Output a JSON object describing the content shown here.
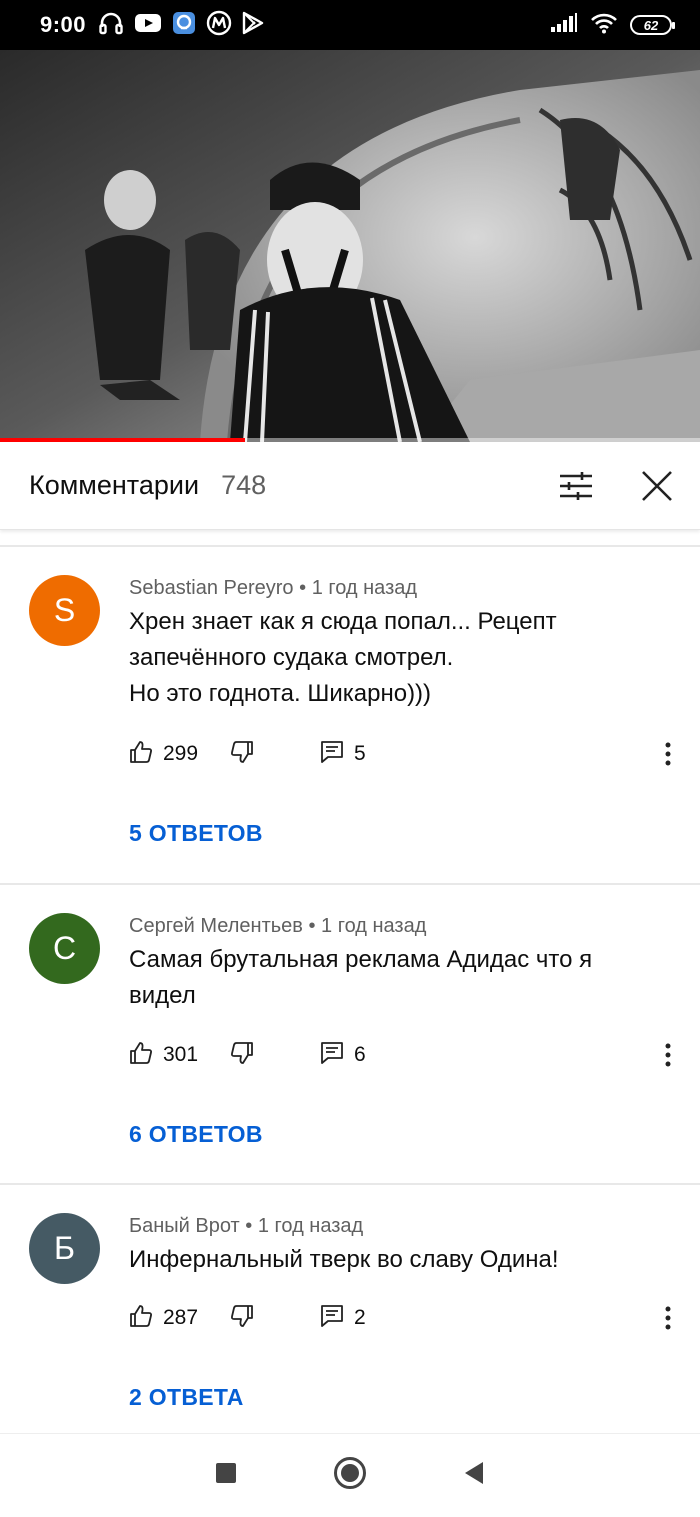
{
  "status_bar": {
    "time": "9:00",
    "left_icons": [
      "headphones-icon",
      "youtube-icon",
      "gallery-app-icon",
      "metro-icon",
      "play-store-icon"
    ],
    "right_icons": [
      "signal-icon",
      "wifi-icon"
    ],
    "battery": "62"
  },
  "video": {
    "progress_percent": 35,
    "colors": {
      "progress": "#ff0000"
    }
  },
  "comments_header": {
    "title": "Комментарии",
    "count": "748"
  },
  "comments": [
    {
      "avatar_letter": "S",
      "avatar_color": "#ef6c00",
      "author": "Sebastian Pereyro",
      "time": "1 год назад",
      "lines": [
        "Хрен знает как я сюда попал... Рецепт",
        "запечённого судака смотрел.",
        "Но это годнота. Шикарно)))"
      ],
      "likes": "299",
      "replies_count": "5",
      "replies_label": "5 ОТВЕТОВ"
    },
    {
      "avatar_letter": "С",
      "avatar_color": "#33691e",
      "author": "Сергей Мелентьев",
      "time": "1 год назад",
      "lines": [
        "Самая брутальная реклама Адидас что я",
        "видел"
      ],
      "likes": "301",
      "replies_count": "6",
      "replies_label": "6 ОТВЕТОВ"
    },
    {
      "avatar_letter": "Б",
      "avatar_color": "#455a64",
      "author": "Баный Врот",
      "time": "1 год назад",
      "lines": [
        "Инфернальный тверк во славу Одина!"
      ],
      "likes": "287",
      "replies_count": "2",
      "replies_label": "2 ОТВЕТА"
    }
  ],
  "meta_separator": "•",
  "colors": {
    "link": "#065fd4",
    "secondary_text": "#606060"
  },
  "nav_bar": [
    "recents-square-icon",
    "home-circle-icon",
    "back-triangle-icon"
  ]
}
